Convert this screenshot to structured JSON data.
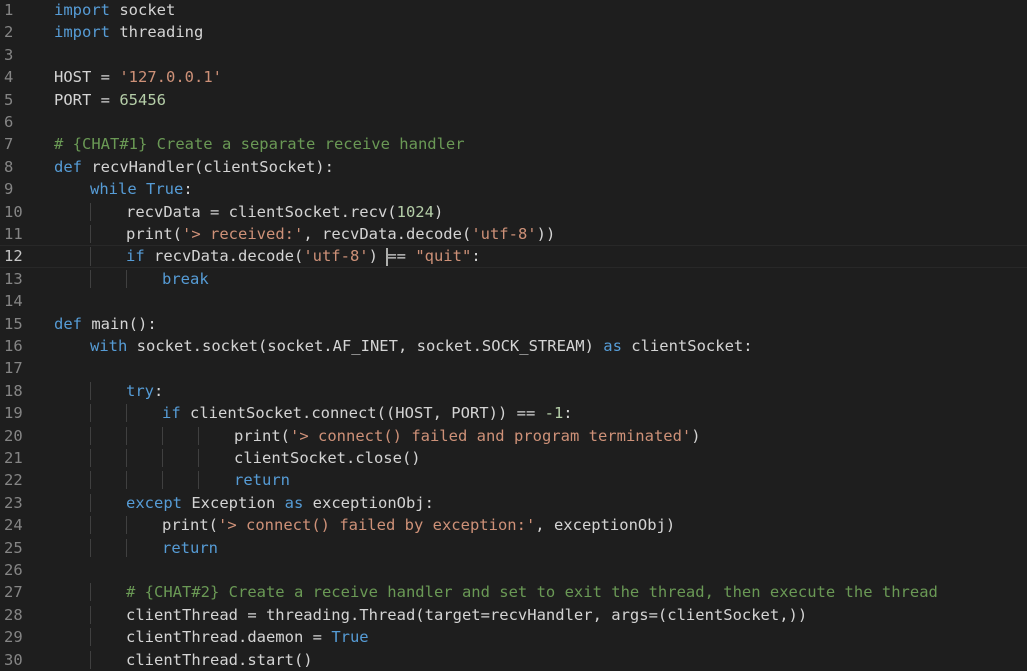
{
  "colors": {
    "background": "#1e1e1e",
    "keyword": "#569cd6",
    "control": "#c586c0",
    "string": "#ce9178",
    "number": "#b5cea8",
    "comment": "#6a9955",
    "default": "#d4d4d4",
    "line_number": "#858585"
  },
  "editor": {
    "current_line": 12,
    "lines": [
      {
        "num": "1",
        "indent": 0,
        "tokens": [
          {
            "t": "import",
            "c": "keyword"
          },
          {
            "t": " socket",
            "c": "default"
          }
        ]
      },
      {
        "num": "2",
        "indent": 0,
        "tokens": [
          {
            "t": "import",
            "c": "keyword"
          },
          {
            "t": " threading",
            "c": "default"
          }
        ]
      },
      {
        "num": "3",
        "indent": 0,
        "tokens": []
      },
      {
        "num": "4",
        "indent": 0,
        "tokens": [
          {
            "t": "HOST = ",
            "c": "default"
          },
          {
            "t": "'127.0.0.1'",
            "c": "string"
          }
        ]
      },
      {
        "num": "5",
        "indent": 0,
        "tokens": [
          {
            "t": "PORT = ",
            "c": "default"
          },
          {
            "t": "65456",
            "c": "number"
          }
        ]
      },
      {
        "num": "6",
        "indent": 0,
        "tokens": []
      },
      {
        "num": "7",
        "indent": 0,
        "tokens": [
          {
            "t": "# {CHAT#1} Create a separate receive handler",
            "c": "comment"
          }
        ]
      },
      {
        "num": "8",
        "indent": 0,
        "tokens": [
          {
            "t": "def",
            "c": "keyword"
          },
          {
            "t": " recvHandler(clientSocket):",
            "c": "default"
          }
        ]
      },
      {
        "num": "9",
        "indent": 1,
        "tokens": [
          {
            "t": "while",
            "c": "keyword"
          },
          {
            "t": " ",
            "c": "default"
          },
          {
            "t": "True",
            "c": "keyword"
          },
          {
            "t": ":",
            "c": "default"
          }
        ]
      },
      {
        "num": "10",
        "indent": 2,
        "tokens": [
          {
            "t": "recvData = clientSocket.recv(",
            "c": "default"
          },
          {
            "t": "1024",
            "c": "number"
          },
          {
            "t": ")",
            "c": "default"
          }
        ]
      },
      {
        "num": "11",
        "indent": 2,
        "tokens": [
          {
            "t": "print(",
            "c": "default"
          },
          {
            "t": "'> received:'",
            "c": "string"
          },
          {
            "t": ", recvData.decode(",
            "c": "default"
          },
          {
            "t": "'utf-8'",
            "c": "string"
          },
          {
            "t": "))",
            "c": "default"
          }
        ]
      },
      {
        "num": "12",
        "indent": 2,
        "tokens": [
          {
            "t": "if",
            "c": "keyword"
          },
          {
            "t": " recvData.decode(",
            "c": "default"
          },
          {
            "t": "'utf-8'",
            "c": "string"
          },
          {
            "t": ") ",
            "c": "default"
          },
          {
            "t": "|",
            "c": "cursor"
          },
          {
            "t": "== ",
            "c": "default"
          },
          {
            "t": "\"quit\"",
            "c": "string"
          },
          {
            "t": ":",
            "c": "default"
          }
        ]
      },
      {
        "num": "13",
        "indent": 3,
        "tokens": [
          {
            "t": "break",
            "c": "keyword"
          }
        ]
      },
      {
        "num": "14",
        "indent": 0,
        "tokens": []
      },
      {
        "num": "15",
        "indent": 0,
        "tokens": [
          {
            "t": "def",
            "c": "keyword"
          },
          {
            "t": " main():",
            "c": "default"
          }
        ]
      },
      {
        "num": "16",
        "indent": 1,
        "tokens": [
          {
            "t": "with",
            "c": "keyword"
          },
          {
            "t": " socket.socket(socket.AF_INET, socket.SOCK_STREAM) ",
            "c": "default"
          },
          {
            "t": "as",
            "c": "keyword"
          },
          {
            "t": " clientSocket:",
            "c": "default"
          }
        ]
      },
      {
        "num": "17",
        "indent": 0,
        "tokens": []
      },
      {
        "num": "18",
        "indent": 2,
        "tokens": [
          {
            "t": "try",
            "c": "keyword"
          },
          {
            "t": ":",
            "c": "default"
          }
        ]
      },
      {
        "num": "19",
        "indent": 3,
        "tokens": [
          {
            "t": "if",
            "c": "keyword"
          },
          {
            "t": " clientSocket.connect((HOST, PORT)) == ",
            "c": "default"
          },
          {
            "t": "-1",
            "c": "number"
          },
          {
            "t": ":",
            "c": "default"
          }
        ]
      },
      {
        "num": "20",
        "indent": 5,
        "tokens": [
          {
            "t": "print(",
            "c": "default"
          },
          {
            "t": "'> connect() failed and program terminated'",
            "c": "string"
          },
          {
            "t": ")",
            "c": "default"
          }
        ]
      },
      {
        "num": "21",
        "indent": 5,
        "tokens": [
          {
            "t": "clientSocket.close()",
            "c": "default"
          }
        ]
      },
      {
        "num": "22",
        "indent": 5,
        "tokens": [
          {
            "t": "return",
            "c": "keyword"
          }
        ]
      },
      {
        "num": "23",
        "indent": 2,
        "tokens": [
          {
            "t": "except",
            "c": "keyword"
          },
          {
            "t": " Exception ",
            "c": "default"
          },
          {
            "t": "as",
            "c": "keyword"
          },
          {
            "t": " exceptionObj:",
            "c": "default"
          }
        ]
      },
      {
        "num": "24",
        "indent": 3,
        "tokens": [
          {
            "t": "print(",
            "c": "default"
          },
          {
            "t": "'> connect() failed by exception:'",
            "c": "string"
          },
          {
            "t": ", exceptionObj)",
            "c": "default"
          }
        ]
      },
      {
        "num": "25",
        "indent": 3,
        "tokens": [
          {
            "t": "return",
            "c": "keyword"
          }
        ]
      },
      {
        "num": "26",
        "indent": 0,
        "tokens": []
      },
      {
        "num": "27",
        "indent": 2,
        "tokens": [
          {
            "t": "# {CHAT#2} Create a receive handler and set to exit the thread, then execute the thread",
            "c": "comment"
          }
        ]
      },
      {
        "num": "28",
        "indent": 2,
        "tokens": [
          {
            "t": "clientThread = threading.Thread(target=recvHandler, args=(clientSocket,))",
            "c": "default"
          }
        ]
      },
      {
        "num": "29",
        "indent": 2,
        "tokens": [
          {
            "t": "clientThread.daemon = ",
            "c": "default"
          },
          {
            "t": "True",
            "c": "keyword"
          }
        ]
      },
      {
        "num": "30",
        "indent": 2,
        "tokens": [
          {
            "t": "clientThread.start()",
            "c": "default"
          }
        ]
      }
    ]
  }
}
